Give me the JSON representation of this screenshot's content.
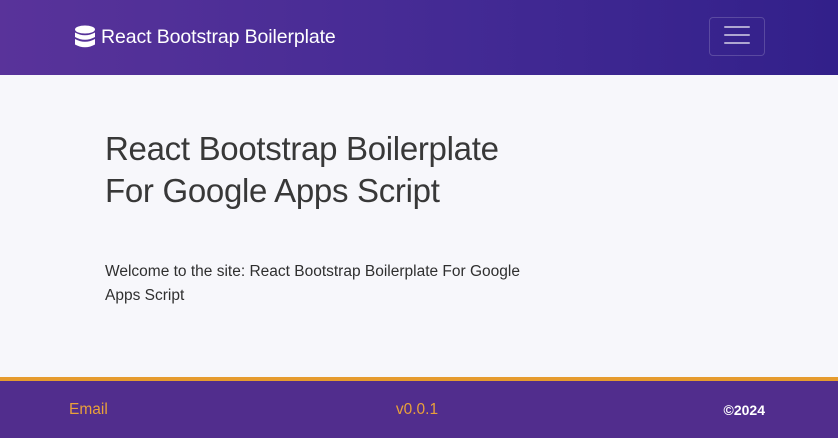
{
  "navbar": {
    "brand_text": "React Bootstrap Boilerplate",
    "brand_icon": "database-icon",
    "toggle_icon": "hamburger-menu-icon"
  },
  "hero": {
    "title": "React Bootstrap Boilerplate For Google Apps Script",
    "text": "Welcome to the site: React Bootstrap Boilerplate For Google Apps Script"
  },
  "footer": {
    "email_label": "Email",
    "version": "v0.0.1",
    "copyright": "©2024"
  },
  "colors": {
    "navbar_gradient_start": "#59339a",
    "navbar_gradient_end": "#32208a",
    "footer_bg": "#512d8d",
    "footer_accent": "#e69b2e",
    "footer_link": "#e9a03a",
    "page_bg": "#f7f7fb"
  }
}
